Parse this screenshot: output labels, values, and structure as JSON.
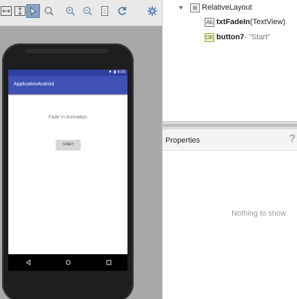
{
  "toolbar": {
    "icons": [
      "fit-width-icon",
      "fit-height-icon",
      "select-tool-icon",
      "zoom-actual-icon",
      "zoom-in-icon",
      "zoom-out-icon",
      "page-icon",
      "refresh-icon",
      "settings-icon"
    ]
  },
  "device": {
    "status_time": "6:00",
    "app_title": "ApplicationAndroid",
    "text_view": "Fade In Animation",
    "button_label": "START"
  },
  "component_tree": {
    "root": {
      "label": "RelativeLayout"
    },
    "children": [
      {
        "name": "txtFadeIn",
        "type": " (TextView)",
        "icon": "Ab"
      },
      {
        "name": "button7",
        "type": " - \"Start\"",
        "icon": "OK"
      }
    ]
  },
  "properties": {
    "title": "Properties",
    "help": "?",
    "empty_text": "Nothing to show"
  },
  "colors": {
    "status_bar": "#303f9f",
    "app_bar": "#3f51b5",
    "design_background": "#a8a8a8"
  }
}
